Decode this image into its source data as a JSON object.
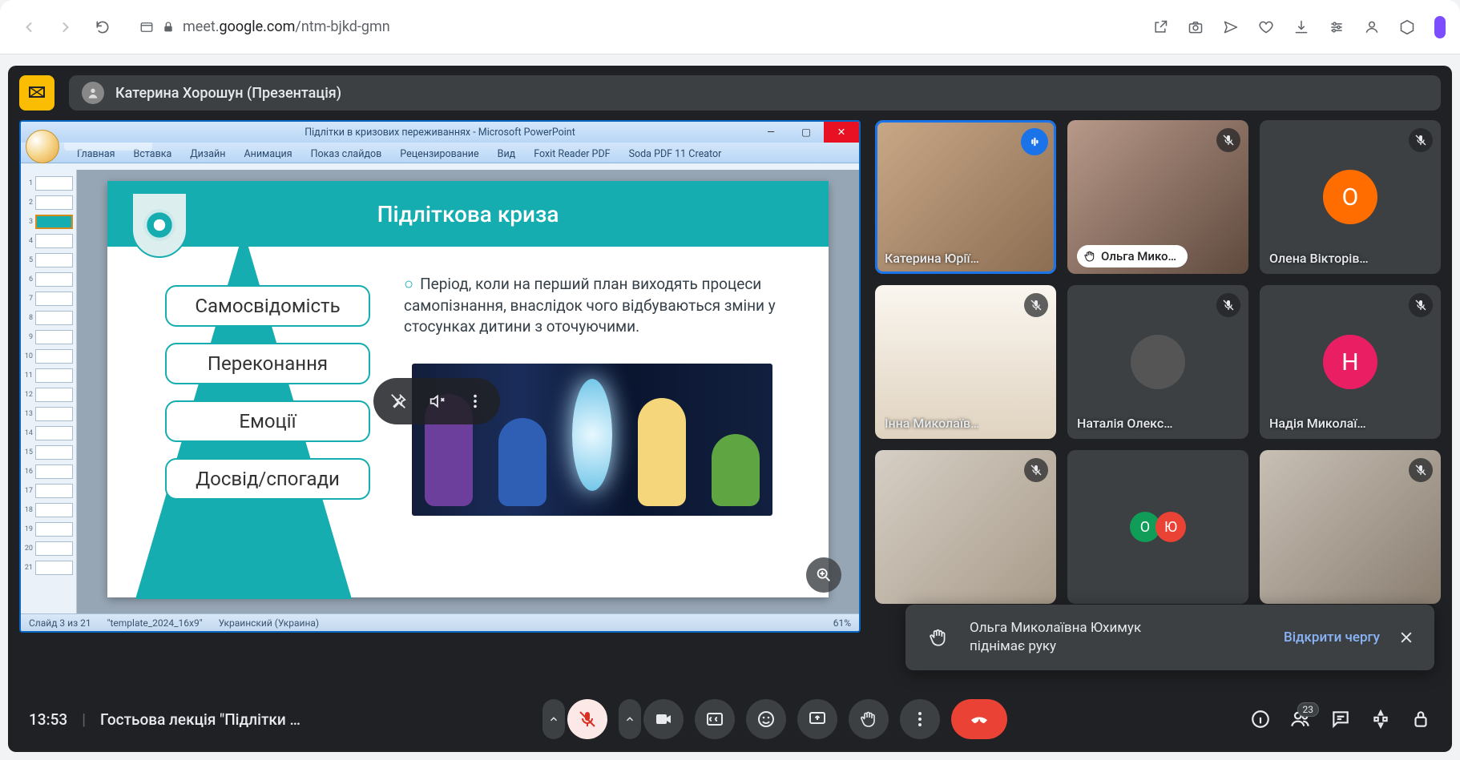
{
  "browser": {
    "url_host": "meet.",
    "url_domain": "google.com",
    "url_path": "/ntm-bjkd-gmn"
  },
  "presenter": {
    "name": "Катерина Хорошун (Презентація)"
  },
  "powerpoint": {
    "window_title": "Підлітки в кризових переживаннях - Microsoft PowerPoint",
    "tabs": [
      "Главная",
      "Вставка",
      "Дизайн",
      "Анимация",
      "Показ слайдов",
      "Рецензирование",
      "Вид",
      "Foxit Reader PDF",
      "Soda PDF 11 Creator"
    ],
    "slide_title": "Підліткова криза",
    "pills": [
      "Самосвідомість",
      "Переконання",
      "Емоції",
      "Досвід/спогади"
    ],
    "bullet": "Період, коли на перший план виходять процеси самопізнання, внаслідок чого відбуваються зміни у стосунках дитини з оточуючими.",
    "status_slide": "Слайд 3 из 21",
    "status_template": "\"template_2024_16x9\"",
    "status_lang": "Украинский (Украина)",
    "status_zoom": "61%",
    "thumb_count": 21,
    "thumb_sel": 3
  },
  "participants": [
    {
      "name": "Катерина Юрії…",
      "type": "video",
      "klass": "v1",
      "speaking": true,
      "muted": false,
      "speak_ic": true
    },
    {
      "name": "Ольга Мико…",
      "type": "video",
      "klass": "v2",
      "chip": true,
      "hand": true,
      "muted": true
    },
    {
      "name": "Олена Вікторів…",
      "type": "avatar",
      "letter": "О",
      "color": "#ff6d01",
      "muted": true
    },
    {
      "name": "Інна Миколаїв…",
      "type": "video",
      "klass": "v3",
      "muted": true
    },
    {
      "name": "Наталія Олекс…",
      "type": "avatar",
      "letter": "",
      "color": "#3c4043",
      "img": true,
      "muted": true
    },
    {
      "name": "Надія Миколаї…",
      "type": "avatar",
      "letter": "Н",
      "color": "#e91e63",
      "muted": true
    },
    {
      "name": "",
      "type": "video",
      "klass": "v4",
      "muted": true
    },
    {
      "name": "",
      "type": "double",
      "letters": [
        "О",
        "Ю"
      ],
      "colors": [
        "#0f9d58",
        "#ea4335"
      ]
    },
    {
      "name": "",
      "type": "video",
      "klass": "v5",
      "muted": true
    }
  ],
  "toast": {
    "line1": "Ольга Миколаївна Юхимук",
    "line2": "піднімає руку",
    "action": "Відкрити чергу"
  },
  "bottom": {
    "time": "13:53",
    "title": "Гостьова лекція \"Підлітки …",
    "badge": "23"
  }
}
